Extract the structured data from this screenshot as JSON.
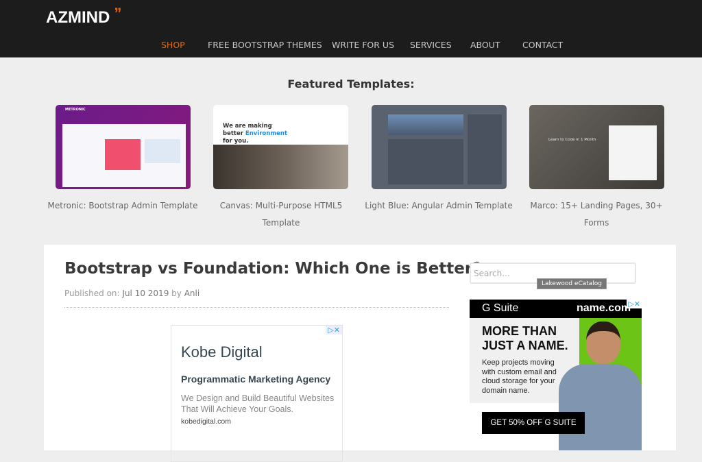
{
  "header": {
    "logo": "AZMIND",
    "logo_mark": "”",
    "nav": [
      {
        "label": "SHOP",
        "active": true
      },
      {
        "label": "FREE BOOTSTRAP THEMES"
      },
      {
        "label": "WRITE FOR US"
      },
      {
        "label": "SERVICES"
      },
      {
        "label": "ABOUT"
      },
      {
        "label": "CONTACT"
      }
    ]
  },
  "featured": {
    "heading": "Featured Templates:",
    "templates": [
      {
        "caption": "Metronic: Bootstrap Admin Template",
        "thumb_text": "METRONIC"
      },
      {
        "caption": "Canvas: Multi-Purpose HTML5 Template",
        "thumb_text": "We are making better",
        "thumb_accent": "Environment",
        "thumb_tail": "for you."
      },
      {
        "caption": "Light Blue: Angular Admin Template"
      },
      {
        "caption": "Marco: 15+ Landing Pages, 30+ Forms",
        "thumb_text": "Learn to Code in 1 Month"
      }
    ]
  },
  "post": {
    "title": "Bootstrap vs Foundation: Which One is Better?",
    "meta_prefix": "Published on:",
    "date": "Jul 10 2019",
    "by": "by",
    "author": "Anli"
  },
  "ad1": {
    "brand": "Kobe Digital",
    "headline": "Programmatic Marketing Agency",
    "body": "We Design and Build Beautiful Websites That Will Achieve Your Goals.",
    "url": "kobedigital.com",
    "choices": "▷✕"
  },
  "sidebar": {
    "search_placeholder": "Search...",
    "tooltip": "Lakewood eCatalog"
  },
  "ad2": {
    "left_brand": "G Suite",
    "right_brand": "name.com",
    "headline": "MORE THAN JUST A NAME.",
    "body": "Keep projects moving with custom email and cloud storage for your domain name.",
    "cta": "GET 50% OFF G SUITE",
    "choices": "▷✕"
  },
  "colors": {
    "accent": "#e8650a",
    "header_bg": "#1c1c1c",
    "ad_green": "#6cc417"
  }
}
